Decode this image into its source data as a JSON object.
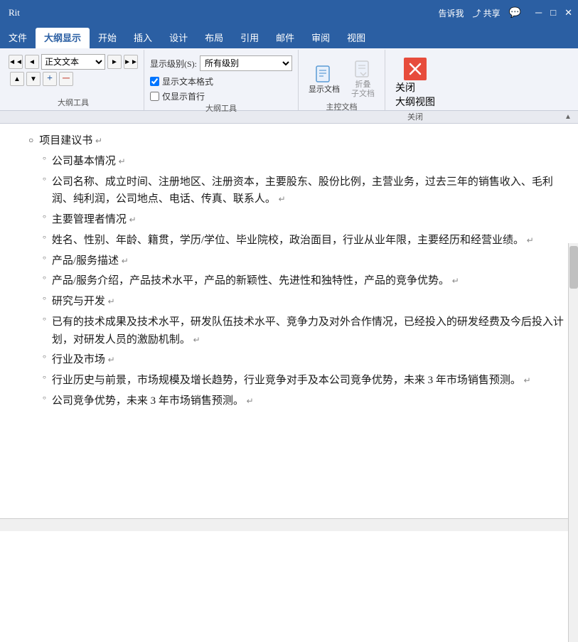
{
  "titleBar": {
    "appName": "Rit",
    "shareLabel": "共享",
    "tellMeLabel": "告诉我"
  },
  "ribbonTabs": [
    {
      "id": "file",
      "label": "文件"
    },
    {
      "id": "outline",
      "label": "大纲显示",
      "active": true
    },
    {
      "id": "start",
      "label": "开始"
    },
    {
      "id": "insert",
      "label": "插入"
    },
    {
      "id": "design",
      "label": "设计"
    },
    {
      "id": "layout",
      "label": "布局"
    },
    {
      "id": "reference",
      "label": "引用"
    },
    {
      "id": "mail",
      "label": "邮件"
    },
    {
      "id": "review",
      "label": "审阅"
    },
    {
      "id": "view",
      "label": "视图"
    }
  ],
  "outlineTools": {
    "sectionLabel": "大纲工具",
    "levelLabel": "显示级别(S):",
    "levelPlaceholder": "",
    "showTextFormat": "显示文本格式",
    "showFirstLine": "仅显示首行",
    "showTextFormatChecked": true,
    "showFirstLineChecked": false,
    "navButtons": [
      "◄◄",
      "◄",
      "►",
      "►►"
    ],
    "styleValue": "正文文本",
    "levelArrows": [
      "▲",
      "▼",
      "+",
      "─"
    ]
  },
  "masterDoc": {
    "sectionLabel": "主控文档",
    "showDocLabel": "显示文档",
    "foldDocLabel": "折叠\n子文档"
  },
  "closeSection": {
    "sectionLabel": "关闭",
    "closeLabel": "关闭\n大纲视图"
  },
  "content": {
    "items": [
      {
        "level": 1,
        "text": "项目建议书",
        "indent": 0
      },
      {
        "level": 2,
        "text": "公司基本情况",
        "indent": 1
      },
      {
        "level": 2,
        "text": "公司名称、成立时间、注册地区、注册资本，主要股东、股份比例，主营业务，过去三年的销售收入、毛利润、纯利润，公司地点、电话、传真、联系人。",
        "indent": 1
      },
      {
        "level": 2,
        "text": "主要管理者情况",
        "indent": 1
      },
      {
        "level": 2,
        "text": "姓名、性别、年龄、籍贯，学历/学位、毕业院校，政治面目，行业从业年限，主要经历和经营业绩。",
        "indent": 1
      },
      {
        "level": 2,
        "text": "产品/服务描述",
        "indent": 1
      },
      {
        "level": 2,
        "text": "产品/服务介绍，产品技术水平，产品的新颖性、先进性和独特性，产品的竞争优势。",
        "indent": 1
      },
      {
        "level": 2,
        "text": "研究与开发",
        "indent": 1
      },
      {
        "level": 2,
        "text": "已有的技术成果及技术水平，研发队伍技术水平、竞争力及对外合作情况，已经投入的研发经费及今后投入计划，对研发人员的激励机制。",
        "indent": 1
      },
      {
        "level": 2,
        "text": "行业及市场",
        "indent": 1
      },
      {
        "level": 2,
        "text": "行业历史与前景，市场规模及增长趋势，行业竞争对手及本公司竞争优势，未来 3 年市场销售预测。",
        "indent": 1
      },
      {
        "level": 2,
        "text": "公司竞争优势，未来 3 年市场销售预测。",
        "indent": 1
      }
    ]
  }
}
